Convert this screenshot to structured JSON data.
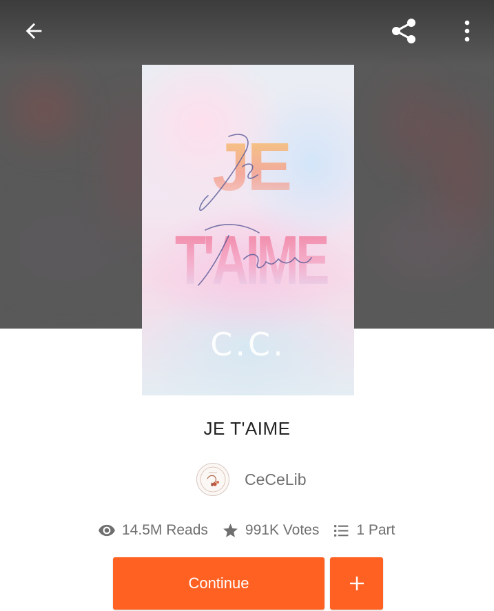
{
  "toolbar": {
    "back_icon": "arrow-back-icon",
    "share_icon": "share-icon",
    "more_icon": "more-vertical-icon"
  },
  "cover": {
    "title_big": "JE T'AIME",
    "title_line1": "JE",
    "title_line2": "T'AIME",
    "script_line1": "Je",
    "script_line2": "T'aime",
    "author_initials": "C.C."
  },
  "story": {
    "title": "JE T'AIME",
    "author": "CeCeLib"
  },
  "stats": {
    "reads": "14.5M Reads",
    "votes": "991K Votes",
    "parts": "1 Part"
  },
  "actions": {
    "continue_label": "Continue",
    "add_icon": "plus-icon"
  },
  "colors": {
    "accent": "#ff6122",
    "header_bg": "#595959",
    "text_primary": "#222222",
    "text_secondary": "#6f6f6f"
  }
}
